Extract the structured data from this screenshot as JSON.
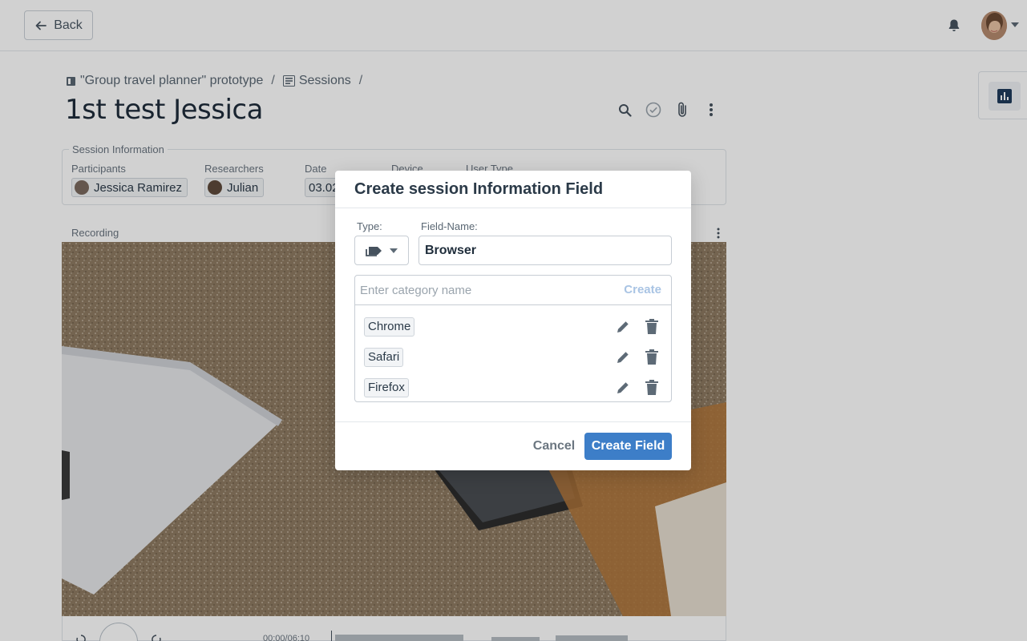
{
  "topbar": {
    "back_label": "Back",
    "bell_icon": "bell-icon",
    "avatar_icon": "user-avatar"
  },
  "breadcrumb": {
    "items": [
      {
        "label": "\"Group travel planner\" prototype",
        "icon": "book-icon"
      },
      {
        "label": "Sessions",
        "icon": "list-icon"
      }
    ],
    "separator": "/"
  },
  "page": {
    "title": "1st test Jessica",
    "actions": [
      "search-icon",
      "check-circle-icon",
      "paperclip-icon",
      "more-vertical-icon"
    ]
  },
  "session_info": {
    "legend": "Session Information",
    "columns": [
      {
        "label": "Participants",
        "value": "Jessica Ramirez"
      },
      {
        "label": "Researchers",
        "value": "Julian"
      },
      {
        "label": "Date",
        "value": "03.02"
      },
      {
        "label": "Device",
        "value": ""
      },
      {
        "label": "User Type",
        "value": ""
      }
    ]
  },
  "recording": {
    "label": "Recording",
    "timecode": "00:00/06:10"
  },
  "modal": {
    "title": "Create session Information Field",
    "type_label": "Type:",
    "type_icon": "label-icon",
    "name_label": "Field-Name:",
    "name_value": "Browser",
    "category_placeholder": "Enter category name",
    "category_create_label": "Create",
    "categories": [
      {
        "label": "Chrome"
      },
      {
        "label": "Safari"
      },
      {
        "label": "Firefox"
      }
    ],
    "cancel_label": "Cancel",
    "submit_label": "Create Field"
  },
  "colors": {
    "primary": "#3d7ec8",
    "create_link": "#a9c4e4",
    "text": "#2b3a48",
    "overlay": "rgba(0,0,0,0.18)"
  }
}
